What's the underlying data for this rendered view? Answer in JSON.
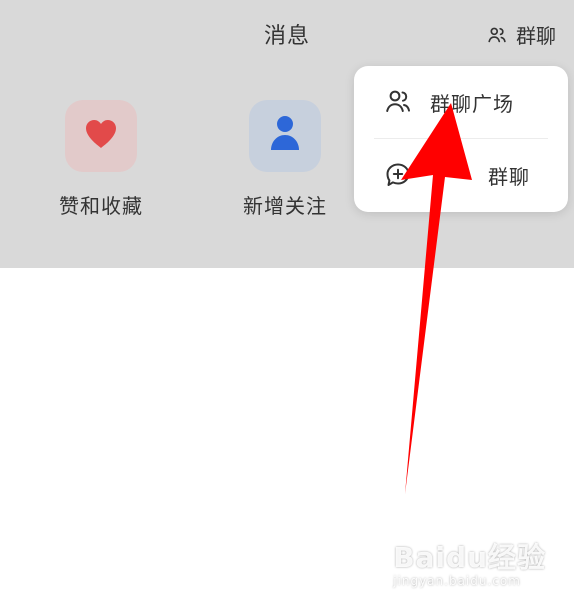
{
  "header": {
    "title": "消息",
    "group_chat_label": "群聊"
  },
  "quick_actions": [
    {
      "label": "赞和收藏",
      "icon": "heart-icon"
    },
    {
      "label": "新增关注",
      "icon": "person-icon"
    }
  ],
  "popup_menu": {
    "items": [
      {
        "label": "群聊广场",
        "icon": "group-icon"
      },
      {
        "label": "群聊",
        "icon": "add-chat-icon"
      }
    ]
  },
  "watermark": {
    "main": "Baidu经验",
    "sub": "jingyan.baidu.com"
  },
  "colors": {
    "background_overlay": "#d9d9d9",
    "like_red": "#e24a4a",
    "follow_blue": "#2d67d8",
    "arrow_red": "#ff0000"
  }
}
